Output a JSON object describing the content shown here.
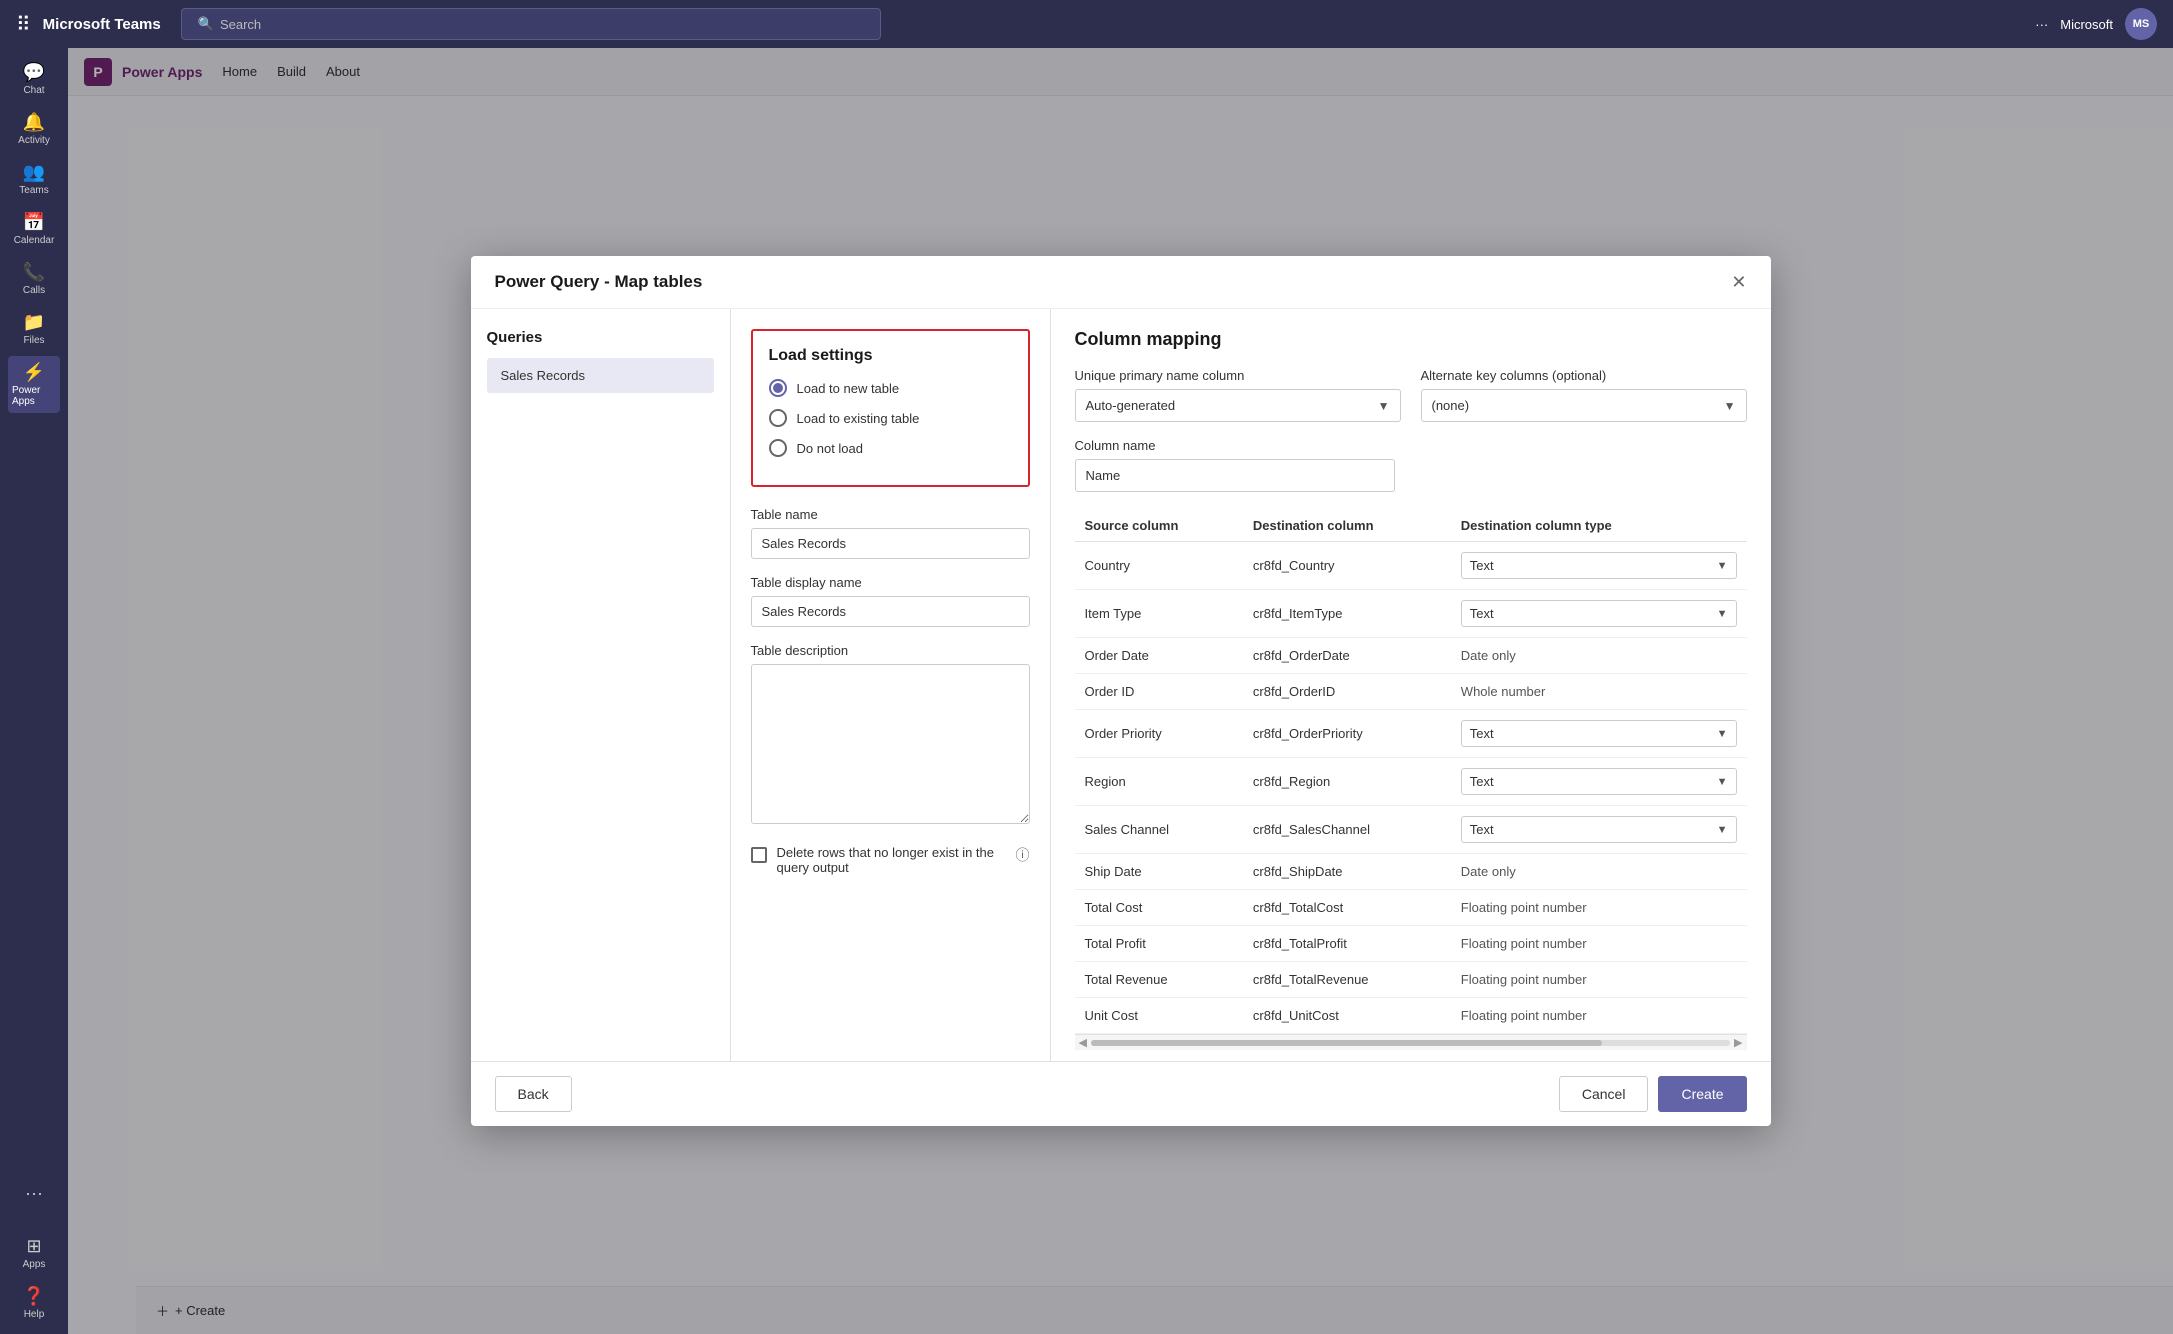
{
  "app": {
    "title": "Microsoft Teams",
    "search_placeholder": "Search"
  },
  "topbar_right": {
    "more_label": "···",
    "user_label": "Microsoft",
    "avatar_label": "MS"
  },
  "sidebar": {
    "items": [
      {
        "id": "chat",
        "label": "Chat",
        "icon": "💬"
      },
      {
        "id": "activity",
        "label": "Activity",
        "icon": "🔔"
      },
      {
        "id": "teams",
        "label": "Teams",
        "icon": "👥"
      },
      {
        "id": "calendar",
        "label": "Calendar",
        "icon": "📅"
      },
      {
        "id": "calls",
        "label": "Calls",
        "icon": "📞"
      },
      {
        "id": "files",
        "label": "Files",
        "icon": "📁"
      },
      {
        "id": "power-apps",
        "label": "Power Apps",
        "icon": "⚡",
        "active": true
      }
    ],
    "more_icon": "···",
    "apps_label": "Apps",
    "help_label": "Help"
  },
  "powerapps": {
    "nav": [
      "Home",
      "Build",
      "About"
    ]
  },
  "modal": {
    "title": "Power Query - Map tables",
    "close_icon": "✕"
  },
  "queries": {
    "heading": "Queries",
    "items": [
      {
        "label": "Sales Records"
      }
    ]
  },
  "load_settings": {
    "heading": "Load settings",
    "options": [
      {
        "id": "new-table",
        "label": "Load to new table",
        "selected": true
      },
      {
        "id": "existing-table",
        "label": "Load to existing table",
        "selected": false
      },
      {
        "id": "do-not-load",
        "label": "Do not load",
        "selected": false
      }
    ]
  },
  "table_form": {
    "table_name_label": "Table name",
    "table_name_value": "Sales Records",
    "table_display_name_label": "Table display name",
    "table_display_name_value": "Sales Records",
    "table_description_label": "Table description",
    "table_description_value": "",
    "delete_rows_label": "Delete rows that no longer exist in the query output"
  },
  "column_mapping": {
    "heading": "Column mapping",
    "unique_primary_label": "Unique primary name column",
    "unique_primary_value": "Auto-generated",
    "alternate_key_label": "Alternate key columns (optional)",
    "alternate_key_value": "(none)",
    "column_name_label": "Column name",
    "column_name_value": "Name",
    "table_headers": [
      "Source column",
      "Destination column",
      "Destination column type"
    ],
    "rows": [
      {
        "source": "Country",
        "destination": "cr8fd_Country",
        "type": "Text",
        "has_dropdown": true
      },
      {
        "source": "Item Type",
        "destination": "cr8fd_ItemType",
        "type": "Text",
        "has_dropdown": true
      },
      {
        "source": "Order Date",
        "destination": "cr8fd_OrderDate",
        "type": "Date only",
        "has_dropdown": false
      },
      {
        "source": "Order ID",
        "destination": "cr8fd_OrderID",
        "type": "Whole number",
        "has_dropdown": false
      },
      {
        "source": "Order Priority",
        "destination": "cr8fd_OrderPriority",
        "type": "Text",
        "has_dropdown": true
      },
      {
        "source": "Region",
        "destination": "cr8fd_Region",
        "type": "Text",
        "has_dropdown": true
      },
      {
        "source": "Sales Channel",
        "destination": "cr8fd_SalesChannel",
        "type": "Text",
        "has_dropdown": true
      },
      {
        "source": "Ship Date",
        "destination": "cr8fd_ShipDate",
        "type": "Date only",
        "has_dropdown": false
      },
      {
        "source": "Total Cost",
        "destination": "cr8fd_TotalCost",
        "type": "Floating point number",
        "has_dropdown": false
      },
      {
        "source": "Total Profit",
        "destination": "cr8fd_TotalProfit",
        "type": "Floating point number",
        "has_dropdown": false
      },
      {
        "source": "Total Revenue",
        "destination": "cr8fd_TotalRevenue",
        "type": "Floating point number",
        "has_dropdown": false
      },
      {
        "source": "Unit Cost",
        "destination": "cr8fd_UnitCost",
        "type": "Floating point number",
        "has_dropdown": false
      }
    ]
  },
  "footer": {
    "back_label": "Back",
    "cancel_label": "Cancel",
    "create_label": "Create"
  },
  "bottom_bar": {
    "create_label": "+ Create"
  }
}
